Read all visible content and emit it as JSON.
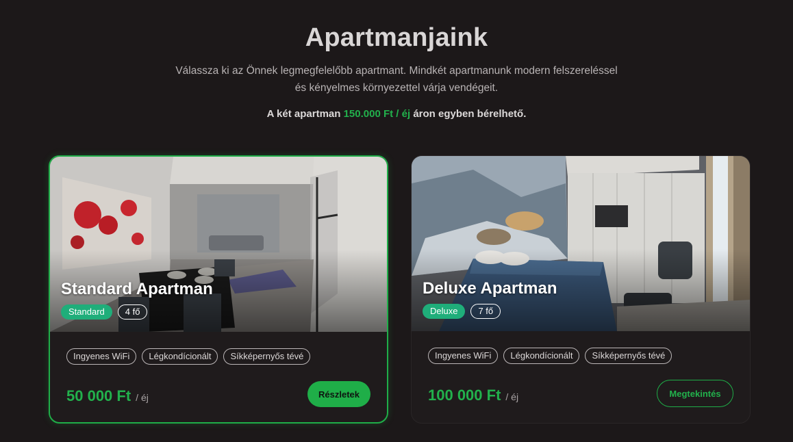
{
  "header": {
    "title": "Apartmanjaink",
    "subtitle_line1": "Válassza ki az Önnek legmegfelelőbb apartmant. Mindkét apartmanunk modern felszereléssel",
    "subtitle_line2": "és kényelmes környezettel várja vendégeit.",
    "price_note_prefix": "A két apartman",
    "price_note_highlight": "150.000 Ft / éj",
    "price_note_suffix": "áron egyben bérelhető."
  },
  "apartments": [
    {
      "name": "Standard Apartman",
      "type_badge": "Standard",
      "capacity": "4 fő",
      "amenities": [
        "Ingyenes WiFi",
        "Légkondícionált",
        "Síkképernyős tévé"
      ],
      "price": "50 000 Ft",
      "price_unit": "/ éj",
      "button": "Részletek",
      "photo_icon": "living-room-photo"
    },
    {
      "name": "Deluxe Apartman",
      "type_badge": "Deluxe",
      "capacity": "7 fő",
      "amenities": [
        "Ingyenes WiFi",
        "Légkondícionált",
        "Síkképernyős tévé"
      ],
      "price": "100 000 Ft",
      "price_unit": "/ éj",
      "button": "Megtekintés",
      "photo_icon": "bedroom-photo"
    }
  ],
  "colors": {
    "background": "#1c1819",
    "accent_green": "#1fae48",
    "badge_teal": "#1fae7a"
  }
}
